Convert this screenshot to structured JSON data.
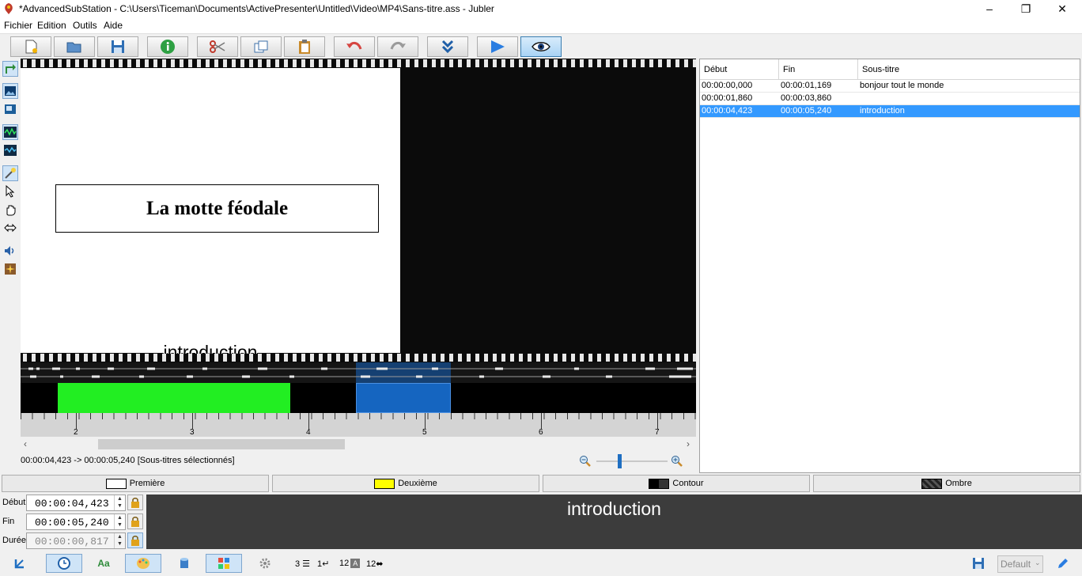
{
  "window": {
    "title": "*AdvancedSubStation - C:\\Users\\Ticeman\\Documents\\ActivePresenter\\Untitled\\Video\\MP4\\Sans-titre.ass - Jubler"
  },
  "menu": [
    "Fichier",
    "Edition",
    "Outils",
    "Aide"
  ],
  "video": {
    "title_text": "La motte féodale",
    "subtitle_overlay": "introduction"
  },
  "ruler_ticks": [
    "2",
    "3",
    "4",
    "5",
    "6",
    "7"
  ],
  "status": {
    "selection": "00:00:04,423 -> 00:00:05,240 [Sous-titres sélectionnés]"
  },
  "table": {
    "headers": [
      "Début",
      "Fin",
      "Sous-titre"
    ],
    "rows": [
      {
        "start": "00:00:00,000",
        "end": "00:00:01,169",
        "text": "bonjour tout le monde"
      },
      {
        "start": "00:00:01,860",
        "end": "00:00:03,860",
        "text": ""
      },
      {
        "start": "00:00:04,423",
        "end": "00:00:05,240",
        "text": "introduction"
      }
    ],
    "selected_row": 2
  },
  "styles": {
    "first": "Première",
    "second": "Deuxième",
    "outline": "Contour",
    "shadow": "Ombre"
  },
  "editor": {
    "start_label": "Début",
    "start_value": "00:00:04,423",
    "end_label": "Fin",
    "end_value": "00:00:05,240",
    "duration_label": "Durée",
    "duration_value": "00:00:00,817",
    "text": "introduction"
  },
  "bottom": {
    "lines_count": "3",
    "newline_count": "1",
    "chars_count": "12",
    "width_count": "12",
    "style_select": "Default"
  },
  "colors": {
    "selection": "#3399ff",
    "track_green": "#22ee22",
    "track_blue": "#1565c0",
    "editor_bg": "#3c3c3c"
  }
}
